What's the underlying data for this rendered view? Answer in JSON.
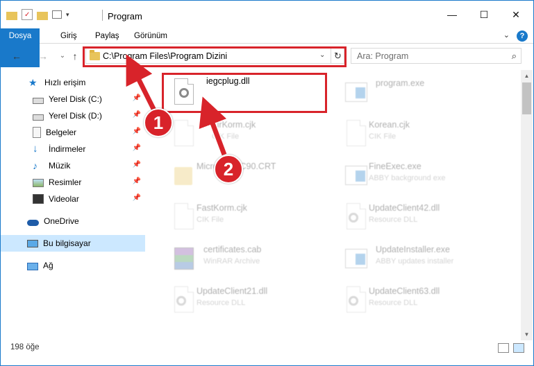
{
  "window": {
    "title": "Program",
    "buttons": {
      "minimize": "—",
      "maximize": "☐",
      "close": "✕"
    }
  },
  "ribbon": {
    "tabs": [
      "Dosya",
      "Giriş",
      "Paylaş",
      "Görünüm"
    ],
    "expand_icon": "chevron-down-icon",
    "help_label": "?"
  },
  "nav": {
    "back": "←",
    "forward": "→",
    "recent": "⌄",
    "up": "↑",
    "address": "C:\\Program Files\\Program Dizini",
    "refresh": "↻",
    "search_placeholder": "Ara: Program",
    "search_icon": "⌕"
  },
  "sidebar": {
    "items": [
      {
        "label": "Hızlı erişim",
        "icon": "star-icon",
        "pinned": false
      },
      {
        "label": "Yerel Disk (C:)",
        "icon": "drive-icon",
        "pinned": true
      },
      {
        "label": "Yerel Disk (D:)",
        "icon": "drive-icon",
        "pinned": true
      },
      {
        "label": "Belgeler",
        "icon": "documents-icon",
        "pinned": true
      },
      {
        "label": "İndirmeler",
        "icon": "download-icon",
        "pinned": true
      },
      {
        "label": "Müzik",
        "icon": "music-icon",
        "pinned": true
      },
      {
        "label": "Resimler",
        "icon": "pictures-icon",
        "pinned": true
      },
      {
        "label": "Videolar",
        "icon": "videos-icon",
        "pinned": true
      },
      {
        "label": "OneDrive",
        "icon": "cloud-icon",
        "pinned": false
      },
      {
        "label": "Bu bilgisayar",
        "icon": "computer-icon",
        "pinned": false,
        "selected": true
      },
      {
        "label": "Ağ",
        "icon": "network-icon",
        "pinned": false
      }
    ]
  },
  "files": [
    {
      "name": "iegcplug.dll",
      "desc": "",
      "icon": "dll-icon",
      "highlighted": true
    },
    {
      "name": "program.exe",
      "desc": "",
      "icon": "exe-icon"
    },
    {
      "name": "FirKorm.cjk",
      "desc": "CIK File",
      "icon": "file-icon"
    },
    {
      "name": "Korean.cjk",
      "desc": "CIK File",
      "icon": "file-icon"
    },
    {
      "name": "Microsoft.VC90.CRT",
      "desc": "",
      "icon": "folder-icon"
    },
    {
      "name": "FineExec.exe",
      "desc": "ABBY background exe",
      "icon": "exe-icon"
    },
    {
      "name": "FastKorm.cjk",
      "desc": "CIK File",
      "icon": "file-icon"
    },
    {
      "name": "UpdateClient42.dll",
      "desc": "Resource DLL",
      "icon": "dll-icon"
    },
    {
      "name": "certificates.cab",
      "desc": "WinRAR Archive",
      "icon": "archive-icon"
    },
    {
      "name": "UpdateInstaller.exe",
      "desc": "ABBY updates installer",
      "icon": "exe-icon"
    },
    {
      "name": "UpdateClient21.dll",
      "desc": "Resource DLL",
      "icon": "dll-icon"
    },
    {
      "name": "UpdateClient63.dll",
      "desc": "Resource DLL",
      "icon": "dll-icon"
    }
  ],
  "status": {
    "count": "198 öğe"
  },
  "callouts": [
    "1",
    "2"
  ],
  "colors": {
    "accent": "#1979ca",
    "highlight": "#d8232a",
    "selected_bg": "#cce8ff"
  }
}
